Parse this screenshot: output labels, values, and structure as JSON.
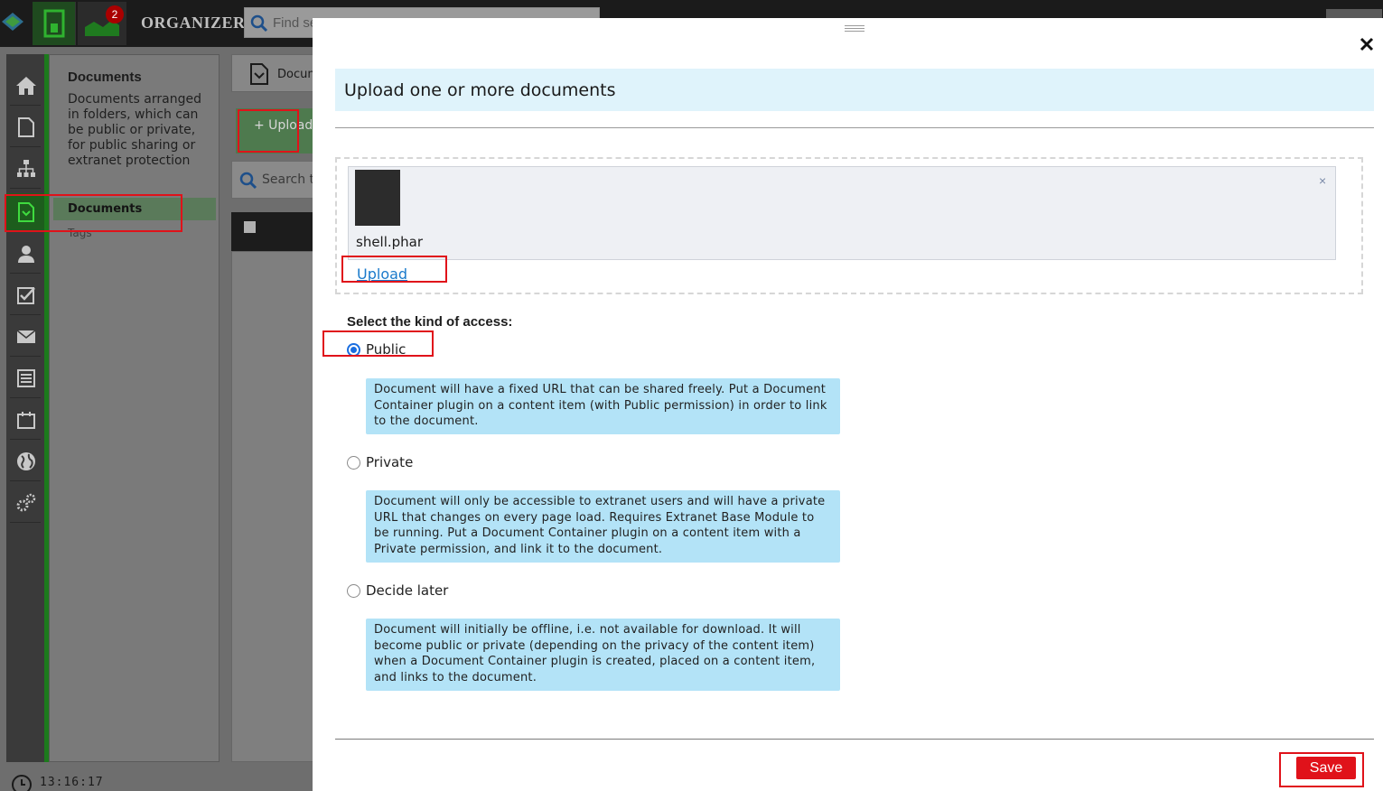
{
  "app": {
    "brand": "ORGANIZER",
    "notification_count": "2",
    "search_placeholder": "Find se",
    "clock": "13:16:17"
  },
  "sidebar": {
    "title": "Documents",
    "description": "Documents arranged in folders, which can be public or private, for public sharing or extranet protection",
    "items": [
      {
        "label": "Documents",
        "active": true
      },
      {
        "label": "Tags",
        "active": false
      }
    ],
    "nav_icons": [
      "home-icon",
      "page-icon",
      "sitemap-icon",
      "document-icon",
      "user-icon",
      "checkbox-icon",
      "mail-icon",
      "form-icon",
      "calendar-icon",
      "globe-icon",
      "gears-icon"
    ]
  },
  "main": {
    "tab_label": "Docum",
    "upload_button": "+ Upload",
    "search_placeholder": "Search t"
  },
  "modal": {
    "title": "Upload one or more documents",
    "file": {
      "name": "shell.phar",
      "remove": "×"
    },
    "upload_link": "Upload",
    "access_label": "Select the kind of access:",
    "options": [
      {
        "label": "Public",
        "checked": true,
        "info": "Document will have a fixed URL that can be shared freely. Put a Document Container plugin on a content item (with Public permission) in order to link to the document."
      },
      {
        "label": "Private",
        "checked": false,
        "info": "Document will only be accessible to extranet users and will have a private URL that changes on every page load. Requires Extranet Base Module to be running. Put a Document Container plugin on a content item with a Private permission, and link it to the document."
      },
      {
        "label": "Decide later",
        "checked": false,
        "info": "Document will initially be offline, i.e. not available for download. It will become public or private (depending on the privacy of the content item) when a Document Container plugin is created, placed on a content item, and links to the document."
      }
    ],
    "save_label": "Save"
  },
  "colors": {
    "accent_green": "#1c7a1c",
    "highlight_red": "#e0121a",
    "info_blue": "#b3e3f7",
    "header_blue": "#dff3fb",
    "link_blue": "#1a7acb"
  }
}
